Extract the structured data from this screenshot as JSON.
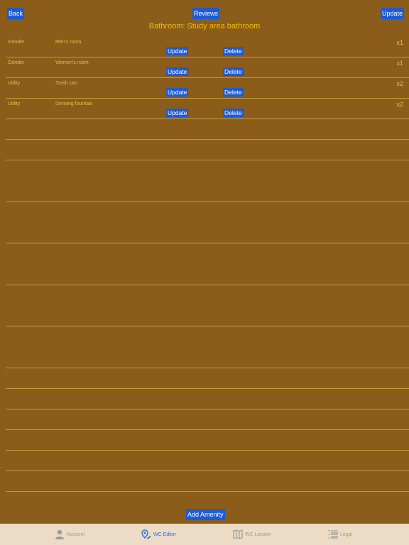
{
  "header": {
    "back_label": "Back",
    "reviews_label": "Reviews",
    "update_label": "Update",
    "title": "Bathroom: Study area bathroom"
  },
  "amenities": [
    {
      "type": "Gender",
      "name": "Men's room",
      "qty": "x1",
      "update_label": "Update",
      "delete_label": "Delete"
    },
    {
      "type": "Gender",
      "name": "Women's room",
      "qty": "x1",
      "update_label": "Update",
      "delete_label": "Delete"
    },
    {
      "type": "Utility",
      "name": "Trash can",
      "qty": "x2",
      "update_label": "Update",
      "delete_label": "Delete"
    },
    {
      "type": "Utility",
      "name": "Drinking fountain",
      "qty": "x2",
      "update_label": "Update",
      "delete_label": "Delete"
    }
  ],
  "footer": {
    "add_amenity_label": "Add Amenity"
  },
  "tabbar": {
    "tabs": [
      {
        "label": "Account",
        "icon": "person-icon",
        "active": false
      },
      {
        "label": "WC Editor",
        "icon": "map-pin-edit-icon",
        "active": true
      },
      {
        "label": "WC Locator",
        "icon": "map-icon",
        "active": false
      },
      {
        "label": "Legal",
        "icon": "list-icon",
        "active": false
      }
    ]
  },
  "colors": {
    "background": "#8b5c1a",
    "button": "#1f5bd0",
    "title_text": "#f0c000",
    "row_text": "#e8c048",
    "separator": "#c49b3a",
    "tabbar_bg": "#ecdcc6",
    "tab_active": "#2a6ee0",
    "tab_inactive": "#9a9a9a"
  }
}
